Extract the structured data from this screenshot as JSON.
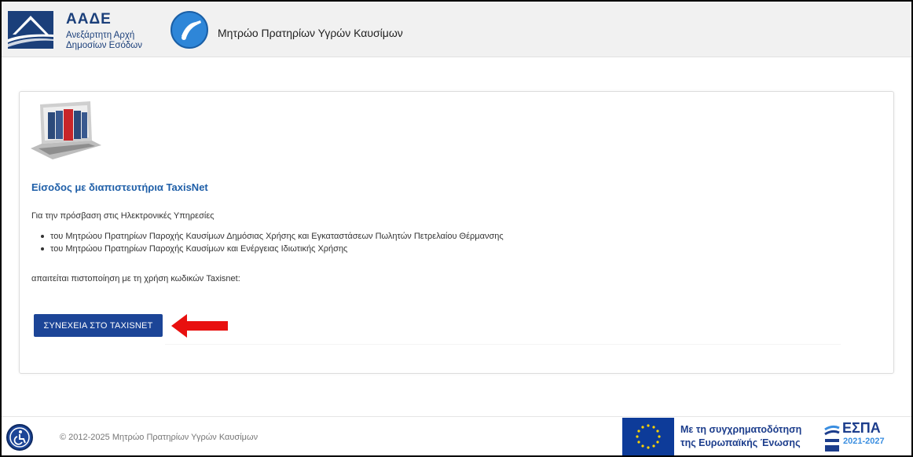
{
  "header": {
    "org_short": "ΑΑΔΕ",
    "org_line1": "Ανεξάρτητη Αρχή",
    "org_line2": "Δημοσίων Εσόδων",
    "app_title": "Μητρώο Πρατηρίων Υγρών Καυσίμων",
    "app_icon": "fuel-pump-icon"
  },
  "main": {
    "login_title": "Είσοδος με διαπιστευτήρια TaxisNet",
    "intro": "Για την πρόσβαση στις Ηλεκτρονικές Υπηρεσίες",
    "bullets": [
      "του Μητρώου Πρατηρίων Παροχής Καυσίμων Δημόσιας Χρήσης και Εγκαταστάσεων Πωλητών Πετρελαίου Θέρμανσης",
      "του Μητρώου Πρατηρίων Παροχής Καυσίμων και Ενέργειας Ιδιωτικής Χρήσης"
    ],
    "auth_note": "απαιτείται πιστοποίηση με τη χρήση κωδικών Taxisnet:",
    "continue_label": "ΣΥΝΕΧΕΙΑ ΣΤΟ TAXISNET",
    "button_color": "#1c4597",
    "arrow_color": "#e8100f"
  },
  "footer": {
    "copyright": "© 2012-2025 Μητρώο Πρατηρίων Υγρών Καυσίμων",
    "cofund_line1": "Με τη συγχρηματοδότηση",
    "cofund_line2": "της Ευρωπαϊκής Ένωσης",
    "espa_title": "ΕΣΠΑ",
    "espa_years": "2021-2027",
    "accessibility_icon": "accessibility-icon"
  }
}
